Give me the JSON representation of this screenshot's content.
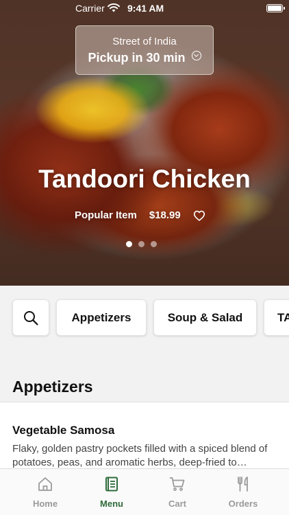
{
  "status_bar": {
    "carrier": "Carrier",
    "time": "9:41 AM"
  },
  "location": {
    "restaurant": "Street of India",
    "pickup": "Pickup in 30 min"
  },
  "hero": {
    "title": "Tandoori Chicken",
    "tag": "Popular Item",
    "price": "$18.99",
    "carousel": {
      "pages": 3,
      "active": 1
    }
  },
  "categories": [
    "Appetizers",
    "Soup & Salad",
    "TA"
  ],
  "section": {
    "title": "Appetizers"
  },
  "item": {
    "name": "Vegetable Samosa",
    "description": "Flaky, golden pastry pockets filled with a spiced blend of potatoes, peas, and aromatic herbs, deep-fried to perfection."
  },
  "tabs": [
    {
      "label": "Home",
      "icon": "home-icon"
    },
    {
      "label": "Menu",
      "icon": "menu-book-icon"
    },
    {
      "label": "Cart",
      "icon": "cart-icon"
    },
    {
      "label": "Orders",
      "icon": "fork-knife-icon"
    }
  ],
  "colors": {
    "accent": "#2f6b3a",
    "inactive": "#9a9a9a"
  }
}
